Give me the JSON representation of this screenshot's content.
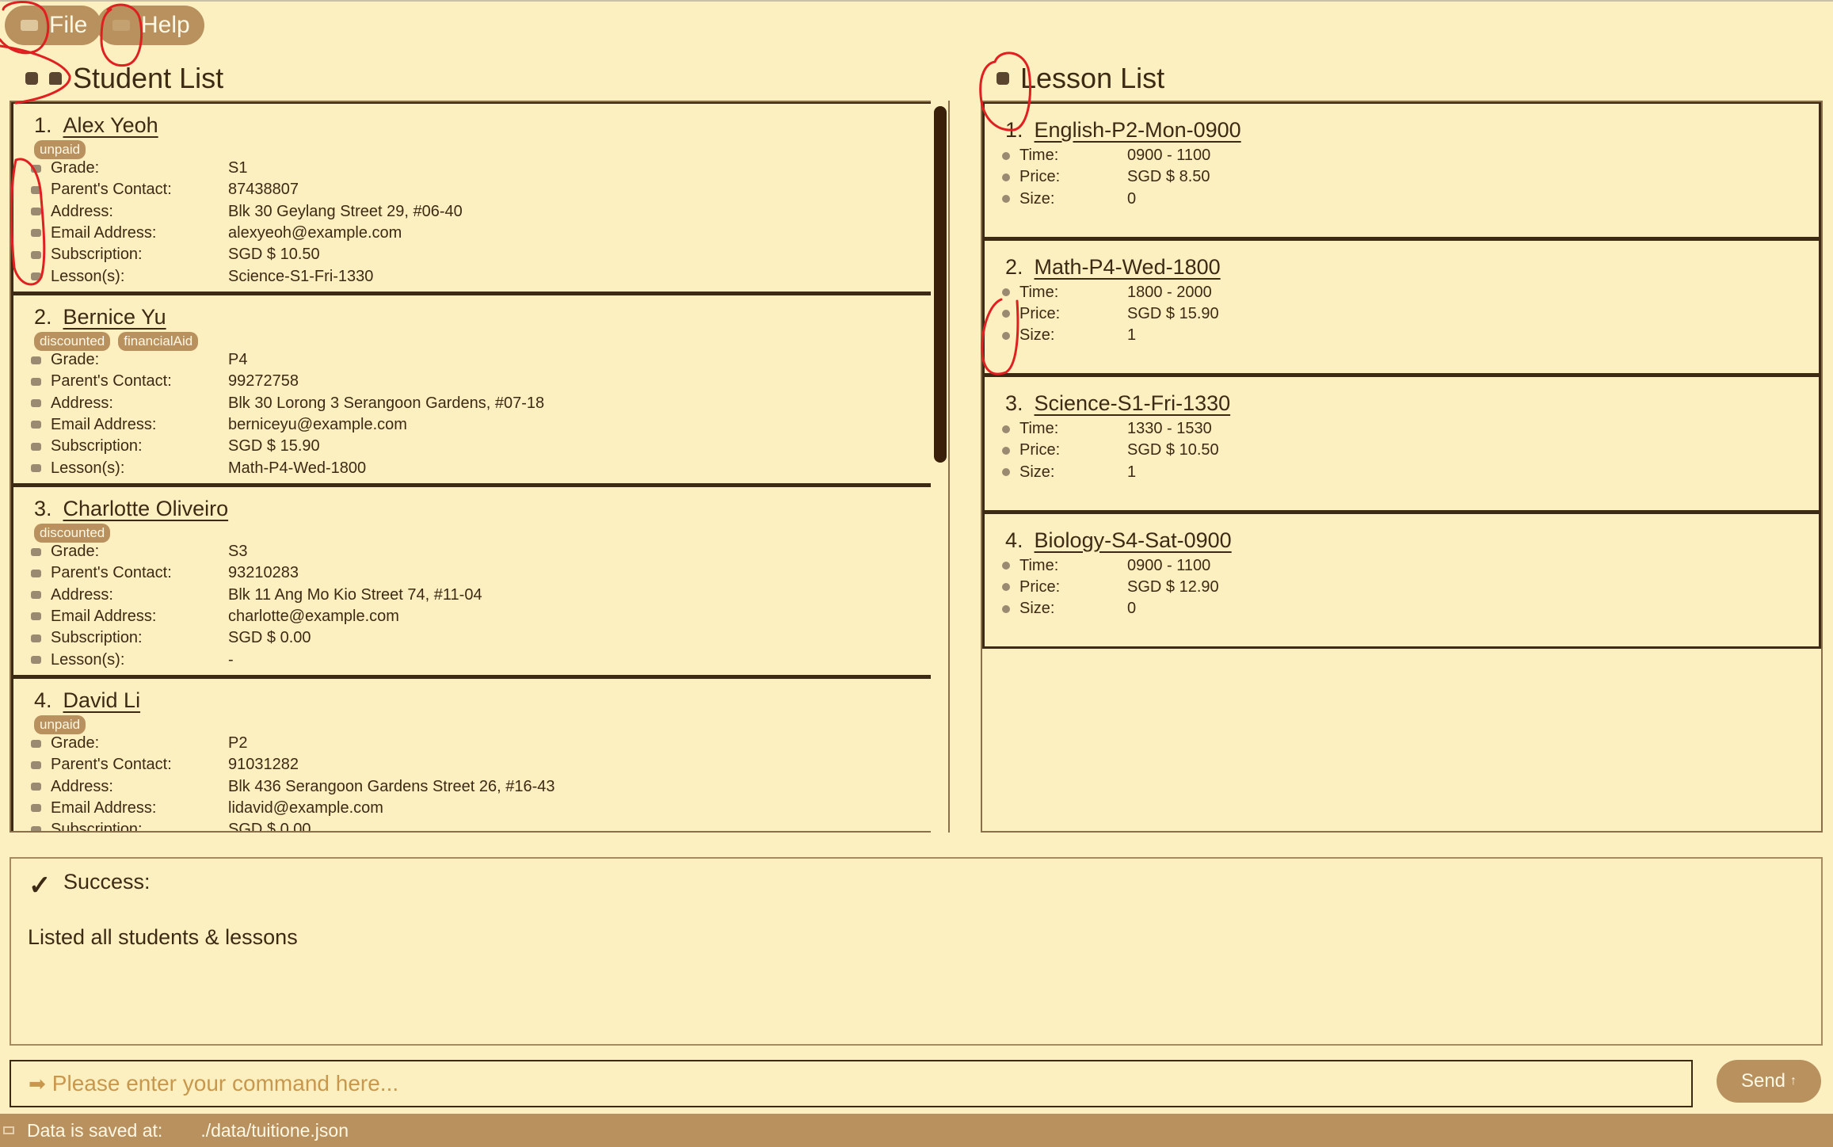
{
  "menu": {
    "file_label": "File",
    "help_label": "Help"
  },
  "student_panel": {
    "title": "Student List",
    "field_labels": {
      "grade": "Grade:",
      "parent": "Parent's Contact:",
      "address": "Address:",
      "email": "Email Address:",
      "subscription": "Subscription:",
      "lessons": "Lesson(s):"
    },
    "students": [
      {
        "index": "1.",
        "name": "Alex Yeoh",
        "tags": [
          "unpaid"
        ],
        "grade": "S1",
        "parent": "87438807",
        "address": "Blk 30 Geylang Street 29, #06-40",
        "email": "alexyeoh@example.com",
        "subscription": "SGD $ 10.50",
        "lessons": "Science-S1-Fri-1330"
      },
      {
        "index": "2.",
        "name": "Bernice Yu",
        "tags": [
          "discounted",
          "financialAid"
        ],
        "grade": "P4",
        "parent": "99272758",
        "address": "Blk 30 Lorong 3 Serangoon Gardens, #07-18",
        "email": "berniceyu@example.com",
        "subscription": "SGD $ 15.90",
        "lessons": "Math-P4-Wed-1800"
      },
      {
        "index": "3.",
        "name": "Charlotte Oliveiro",
        "tags": [
          "discounted"
        ],
        "grade": "S3",
        "parent": "93210283",
        "address": "Blk 11 Ang Mo Kio Street 74, #11-04",
        "email": "charlotte@example.com",
        "subscription": "SGD $ 0.00",
        "lessons": "-"
      },
      {
        "index": "4.",
        "name": "David Li",
        "tags": [
          "unpaid"
        ],
        "grade": "P2",
        "parent": "91031282",
        "address": "Blk 436 Serangoon Gardens Street 26, #16-43",
        "email": "lidavid@example.com",
        "subscription": "SGD $ 0.00",
        "lessons": ""
      }
    ]
  },
  "lesson_panel": {
    "title": "Lesson List",
    "field_labels": {
      "time": "Time:",
      "price": "Price:",
      "size": "Size:"
    },
    "lessons": [
      {
        "index": "1.",
        "name": "English-P2-Mon-0900",
        "time": "0900 - 1100",
        "price": "SGD $ 8.50",
        "size": "0"
      },
      {
        "index": "2.",
        "name": "Math-P4-Wed-1800",
        "time": "1800 - 2000",
        "price": "SGD $ 15.90",
        "size": "1"
      },
      {
        "index": "3.",
        "name": "Science-S1-Fri-1330",
        "time": "1330 - 1530",
        "price": "SGD $ 10.50",
        "size": "1"
      },
      {
        "index": "4.",
        "name": "Biology-S4-Sat-0900",
        "time": "0900 - 1100",
        "price": "SGD $ 12.90",
        "size": "0"
      }
    ]
  },
  "result": {
    "check": "✓",
    "title": "Success:",
    "message": "Listed all students & lessons"
  },
  "command": {
    "arrow": "➡",
    "placeholder": "Please enter your command here...",
    "value": ""
  },
  "send_button": {
    "label": "Send",
    "icon": "↑"
  },
  "status_bar": {
    "label": "Data is saved at:",
    "path": "./data/tuitione.json"
  },
  "colors": {
    "background": "#fdf0c0",
    "accent": "#b8915e",
    "text": "#3d2a14",
    "annotation": "#e02020"
  }
}
